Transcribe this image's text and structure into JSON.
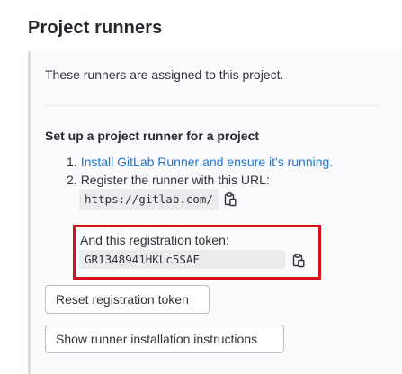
{
  "page": {
    "title": "Project runners"
  },
  "panel": {
    "assigned_text": "These runners are assigned to this project.",
    "setup_heading": "Set up a project runner for a project",
    "steps": [
      {
        "number": "1.",
        "link_text": "Install GitLab Runner and ensure it's running."
      },
      {
        "number": "2.",
        "text": "Register the runner with this URL:"
      }
    ],
    "url_value": "https://gitlab.com/",
    "token_label": "And this registration token:",
    "token_value": "GR1348941HKLc5SAF",
    "reset_button_label": "Reset registration token",
    "show_instructions_button_label": "Show runner installation instructions"
  },
  "icons": {
    "copy_url": "clipboard-icon",
    "copy_token": "clipboard-icon"
  },
  "colors": {
    "link": "#1f75cb",
    "highlight_border": "#d8121a",
    "panel_background": "#fbfafd",
    "panel_border": "#dcdcde"
  }
}
